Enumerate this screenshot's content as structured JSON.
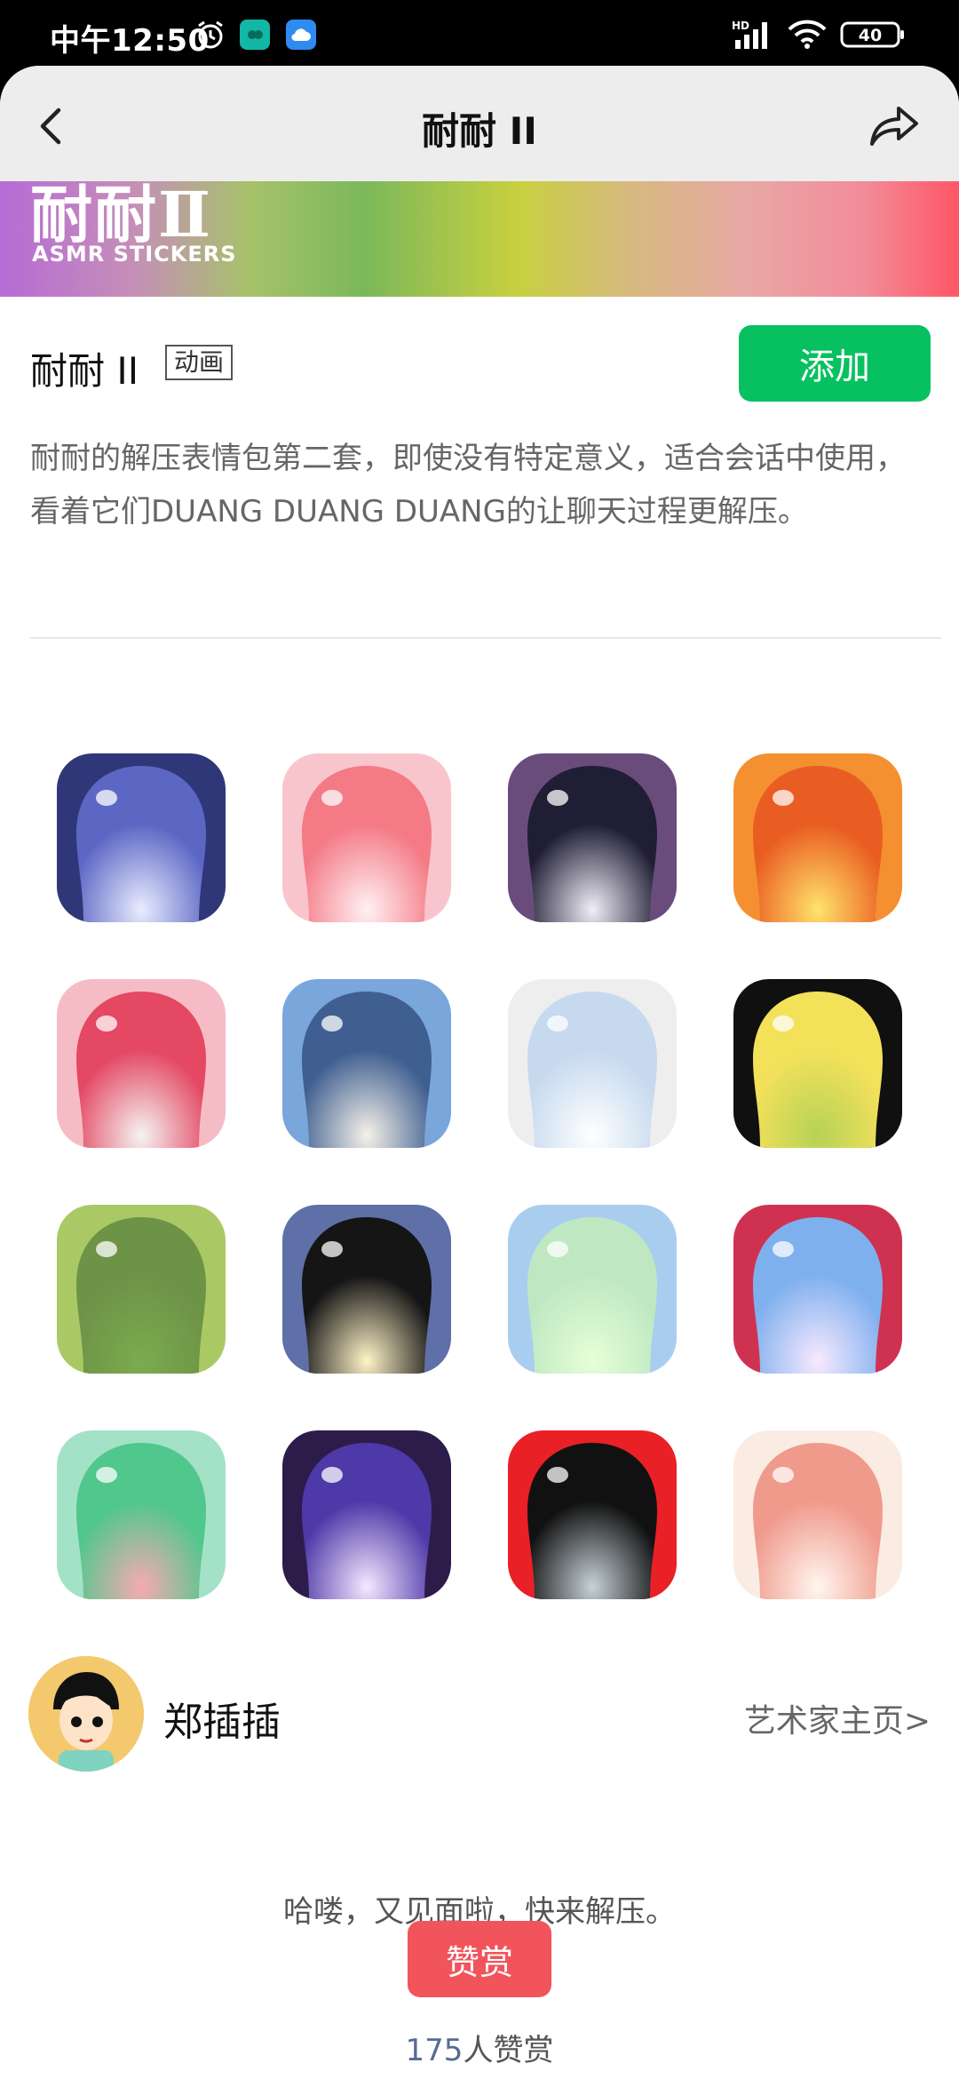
{
  "status_bar": {
    "time": "中午12:50",
    "battery": "40",
    "network": "HD"
  },
  "header": {
    "title": "耐耐 II"
  },
  "banner": {
    "title": "耐耐Ⅱ",
    "subtitle": "ASMR STICKERS"
  },
  "pack": {
    "name": "耐耐 II",
    "tag": "动画",
    "add_label": "添加",
    "description": "耐耐的解压表情包第二套，即使没有特定意义，适合会话中使用，看着它们DUANG DUANG DUANG的让聊天过程更解压。"
  },
  "stickers": [
    {
      "bg": "#2f3778",
      "body": "#5c67c4",
      "glow": "#e9ecff"
    },
    {
      "bg": "#f9c5cc",
      "body": "#f47a86",
      "glow": "#fff1f2"
    },
    {
      "bg": "#6a4c7c",
      "body": "#1f1e34",
      "glow": "#f1eef8"
    },
    {
      "bg": "#f4902f",
      "body": "#ea5d22",
      "glow": "#ffe36a"
    },
    {
      "bg": "#f6bcc5",
      "body": "#e44863",
      "glow": "#f4f4f2"
    },
    {
      "bg": "#79a6db",
      "body": "#3f5f91",
      "glow": "#f6f2e8"
    },
    {
      "bg": "#eeeeee",
      "body": "#c6d9ee",
      "glow": "#ffffff"
    },
    {
      "bg": "#101010",
      "body": "#f4e15a",
      "glow": "#b6d256"
    },
    {
      "bg": "#aac964",
      "body": "#6d9347",
      "glow": "#7cab4e"
    },
    {
      "bg": "#5f6fa7",
      "body": "#151515",
      "glow": "#fff4c8"
    },
    {
      "bg": "#a9cdef",
      "body": "#bfe8c2",
      "glow": "#e6ffd8"
    },
    {
      "bg": "#cf3251",
      "body": "#7fb0ee",
      "glow": "#f8e9ff"
    },
    {
      "bg": "#a3e2c6",
      "body": "#50c78c",
      "glow": "#f6aab3"
    },
    {
      "bg": "#2d1c4a",
      "body": "#4e39a8",
      "glow": "#f4e8ff"
    },
    {
      "bg": "#ea2027",
      "body": "#111111",
      "glow": "#c7d2d8"
    },
    {
      "bg": "#faece2",
      "body": "#f09a8c",
      "glow": "#fff6ef"
    }
  ],
  "artist": {
    "name": "郑插插",
    "homepage_label": "艺术家主页>"
  },
  "greeting": "哈喽，又见面啦，快来解压。",
  "reward": {
    "button_label": "赞赏",
    "count": "175",
    "count_suffix": "人赞赏"
  }
}
